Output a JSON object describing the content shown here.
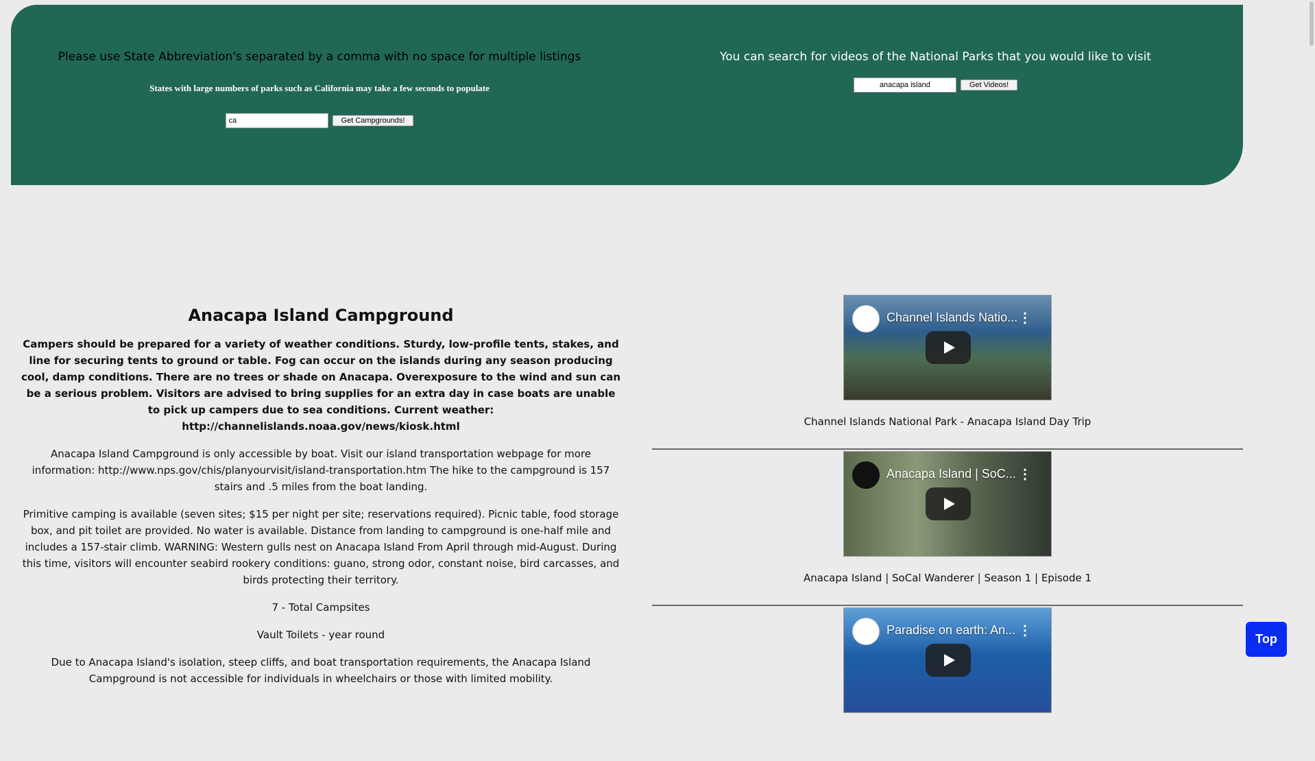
{
  "search": {
    "instructions": "Please use State Abbreviation's separated by a comma with no space for multiple listings",
    "note": "States with large numbers of parks such as California may take a few seconds to populate",
    "state_value": "ca",
    "campground_button": "Get Campgrounds!",
    "video_instructions": "You can search for videos of the National Parks that you would like to visit",
    "video_value": "anacapa island",
    "video_button": "Get Videos!"
  },
  "campground": {
    "title": "Anacapa Island Campground",
    "weather": "Campers should be prepared for a variety of weather conditions. Sturdy, low-profile tents, stakes, and line for securing tents to ground or table. Fog can occur on the islands during any season producing cool, damp conditions. There are no trees or shade on Anacapa. Overexposure to the wind and sun can be a serious problem. Visitors are advised to bring supplies for an extra day in case boats are unable to pick up campers due to sea conditions. Current weather: http://channelislands.noaa.gov/news/kiosk.html",
    "access": "Anacapa Island Campground is only accessible by boat. Visit our island transportation webpage for more information: http://www.nps.gov/chis/planyourvisit/island-transportation.htm The hike to the campground is 157 stairs and .5 miles from the boat landing.",
    "description": "Primitive camping is available (seven sites; $15 per night per site; reservations required). Picnic table, food storage box, and pit toilet are provided. No water is available. Distance from landing to campground is one-half mile and includes a 157-stair climb. WARNING: Western gulls nest on Anacapa Island From April through mid-August. During this time, visitors will encounter seabird rookery conditions: guano, strong odor, constant noise, bird carcasses, and birds protecting their territory.",
    "campsites": "7 - Total Campsites",
    "toilets": "Vault Toilets - year round",
    "accessibility": "Due to Anacapa Island's isolation, steep cliffs, and boat transportation requirements, the Anacapa Island Campground is not accessible for individuals in wheelchairs or those with limited mobility."
  },
  "videos": [
    {
      "thumb_title": "Channel Islands Natio...",
      "caption": "Channel Islands National Park - Anacapa Island Day Trip"
    },
    {
      "thumb_title": "Anacapa Island | SoC...",
      "caption": "Anacapa Island | SoCal Wanderer | Season 1 | Episode 1"
    },
    {
      "thumb_title": "Paradise on earth: An...",
      "caption": ""
    }
  ],
  "top_button": "Top",
  "colors": {
    "header_bg": "#216755",
    "page_bg": "#ebebeb",
    "top_button": "#0a2cf2"
  },
  "icons": [
    "play-icon",
    "more-vert-icon",
    "channel-avatar-icon"
  ]
}
